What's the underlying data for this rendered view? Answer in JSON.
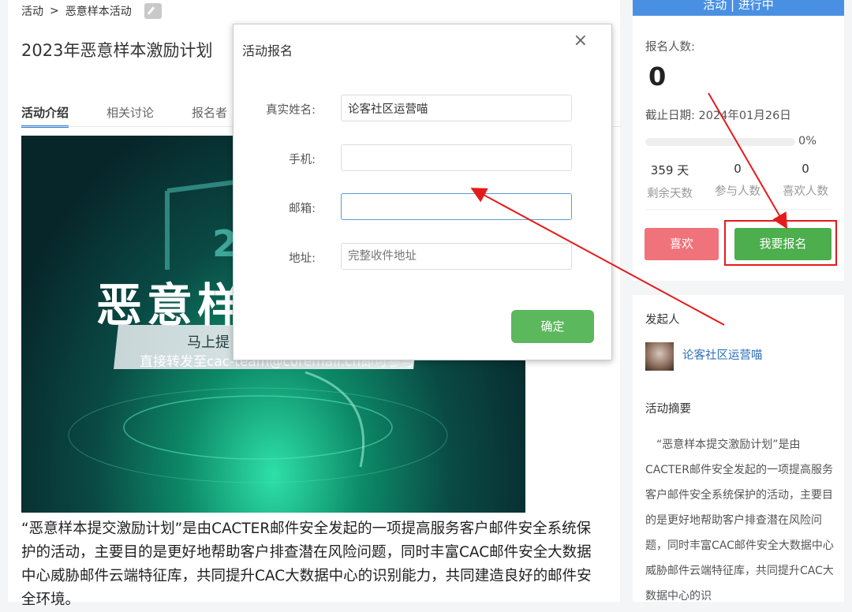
{
  "breadcrumb": {
    "root": "活动",
    "sep": ">",
    "current": "恶意样本活动"
  },
  "page_title": "2023年恶意样本激励计划",
  "tabs": [
    {
      "label": "活动介绍"
    },
    {
      "label": "相关讨论"
    },
    {
      "label": "报名者"
    }
  ],
  "banner": {
    "big_text": "恶意样",
    "number": "2",
    "line1": "马上提",
    "line2": "直接转发至cac-team@coremail.cn即可参与"
  },
  "description": "“恶意样本提交激励计划”是由CACTER邮件安全发起的一项提高服务客户邮件安全系统保护的活动，主要目的是更好地帮助客户排查潜在风险问题，同时丰富CAC邮件安全大数据中心威胁邮件云端特征库，共同提升CAC大数据中心的识别能力，共同建造良好的邮件安全环境。",
  "sidebar": {
    "status": "活动 | 进行中",
    "signup_label": "报名人数:",
    "signup_count": "0",
    "deadline": "截止日期: 2024年01月26日",
    "progress_percent": "0%",
    "progress_value": 0,
    "stats": [
      {
        "value": "359 天",
        "label": "剩余天数"
      },
      {
        "value": "0",
        "label": "参与人数"
      },
      {
        "value": "0",
        "label": "喜欢人数"
      }
    ],
    "like_button": "喜欢",
    "signup_button": "我要报名",
    "organizer_heading": "发起人",
    "organizer_name": "论客社区运营喵",
    "summary_heading": "活动摘要",
    "summary_text": "“恶意样本提交激励计划”是由CACTER邮件安全发起的一项提高服务客户邮件安全系统保护的活动，主要目的是更好地帮助客户排查潜在风险问题，同时丰富CAC邮件安全大数据中心威胁邮件云端特征库，共同提升CAC大数据中心的识"
  },
  "dialog": {
    "title": "活动报名",
    "close": "×",
    "fields": [
      {
        "label": "真实姓名:",
        "value": "论客社区运营喵",
        "placeholder": ""
      },
      {
        "label": "手机:",
        "value": "",
        "placeholder": ""
      },
      {
        "label": "邮箱:",
        "value": "",
        "placeholder": ""
      },
      {
        "label": "地址:",
        "value": "",
        "placeholder": "完整收件地址"
      }
    ],
    "confirm": "确定"
  },
  "colors": {
    "accent": "#4a90e2",
    "like": "#f0727b",
    "signup": "#4cae4c",
    "confirm": "#5cb85c",
    "annotation": "#e51b1b"
  }
}
